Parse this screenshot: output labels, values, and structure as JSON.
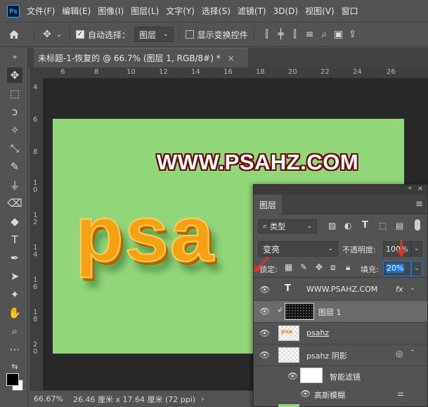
{
  "app": {
    "logo": "Ps"
  },
  "menu": [
    "文件(F)",
    "编辑(E)",
    "图像(I)",
    "图层(L)",
    "文字(Y)",
    "选择(S)",
    "滤镜(T)",
    "3D(D)",
    "视图(V)",
    "窗口"
  ],
  "options": {
    "auto_select_label": "自动选择：",
    "auto_select_value": "图层",
    "show_transform_label": "显示变换控件"
  },
  "document_tab": {
    "title": "未标题-1-恢复的 @ 66.7% (图层 1, RGB/8#) *",
    "close": "×"
  },
  "ruler": {
    "top": [
      "6",
      "8",
      "10",
      "12",
      "14",
      "16",
      "18",
      "20",
      "22",
      "24",
      "26"
    ],
    "left": [
      "4",
      "6",
      "8",
      "1\n0",
      "1\n2",
      "1\n4",
      "1\n6",
      "1\n8",
      "2\n0"
    ]
  },
  "canvas": {
    "watermark": "WWW.PSAHZ.COM",
    "effect_text": "psa",
    "background_color": "#92d67a",
    "effect_color": "#f4a214"
  },
  "status": {
    "zoom": "66.67%",
    "doc_info": "26.46 厘米 x 17.64 厘米 (72 ppi)",
    "arrow": "›"
  },
  "layers_panel": {
    "tab": "图层",
    "filter_kind": "类型",
    "blend_mode": "变亮",
    "opacity_label": "不透明度:",
    "opacity_value": "100%",
    "lock_label": "锁定:",
    "fill_label": "填充:",
    "fill_value": "20%",
    "layers": [
      {
        "name": "WWW.PSAHZ.COM",
        "kind": "text",
        "fx": "fx"
      },
      {
        "name": "图层 1",
        "kind": "pixel",
        "selected": true
      },
      {
        "name": "psahz",
        "kind": "smart"
      },
      {
        "name": "psahz 阴影",
        "kind": "smart"
      },
      {
        "name": "智能滤镜",
        "kind": "filter-mask"
      },
      {
        "name": "高斯模糊",
        "kind": "filter"
      }
    ]
  },
  "colors": {
    "accent": "#1473e6",
    "annotation_red": "#e0312a"
  }
}
